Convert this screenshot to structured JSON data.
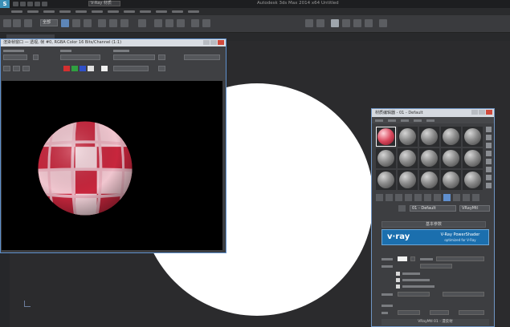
{
  "app": {
    "title": "Autodesk 3ds Max  2014 x64     Untitled",
    "search_placeholder": "V-Ray 材质"
  },
  "toolbar": {
    "selection_filter": "全部"
  },
  "render_window": {
    "title": "渲染帧窗口 — 透视, 帧 #0, RGBA Color 16 Bits/Channel (1:1)"
  },
  "material_editor": {
    "title": "材质编辑器 - 01 - Default",
    "material_name": "01 - Default",
    "material_type": "VRayMtl",
    "rollout_header": "基本参数",
    "vray_logo": "v·ray",
    "vray_title": "V-Ray PowerShader",
    "vray_subtitle": "optimized for V-Ray",
    "status": "VRayMtl 01 - 漫反射",
    "selected_slot": 0,
    "slot_count": 15
  },
  "colors": {
    "accent_blue": "#5d8fcc",
    "vray_blue": "#1b6fae",
    "material_red": "#c8263d"
  }
}
